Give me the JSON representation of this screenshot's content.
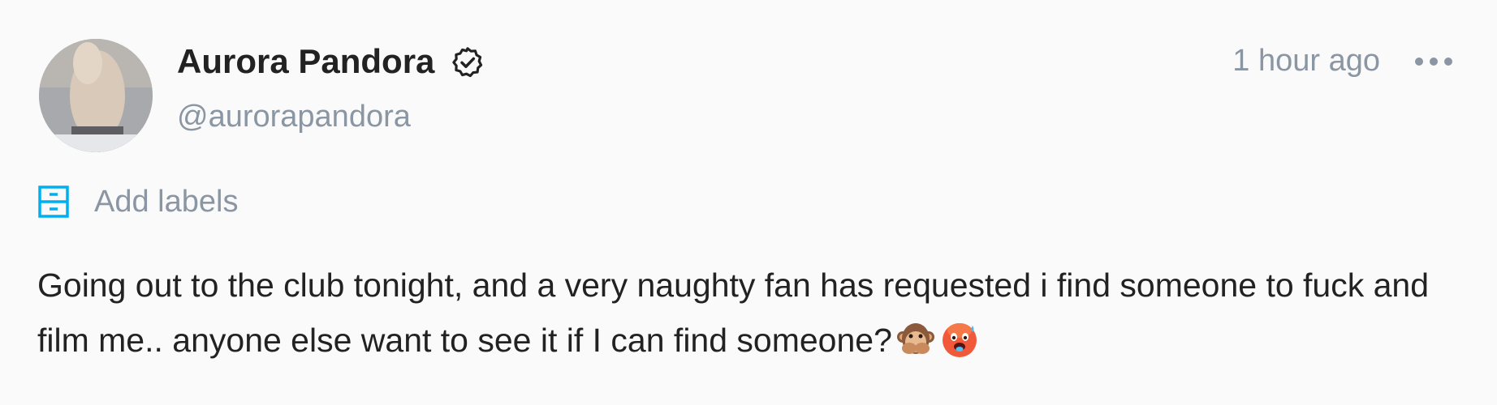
{
  "post": {
    "author_name": "Aurora Pandora",
    "author_handle": "@aurorapandora",
    "time_ago": "1 hour ago",
    "add_labels": "Add labels",
    "text": "Going out to the club tonight, and a very naughty fan has requested i find someone to fuck and film me.. anyone else want to see it if I can find someone?",
    "emojis": [
      "speak-no-evil-monkey",
      "hot-face"
    ]
  },
  "colors": {
    "accent": "#00aff0",
    "muted": "#8a96a3",
    "text": "#222222"
  },
  "icons": {
    "verified": "verified-badge-icon",
    "more": "more-dots-icon",
    "labels": "bookmark-labels-icon"
  }
}
